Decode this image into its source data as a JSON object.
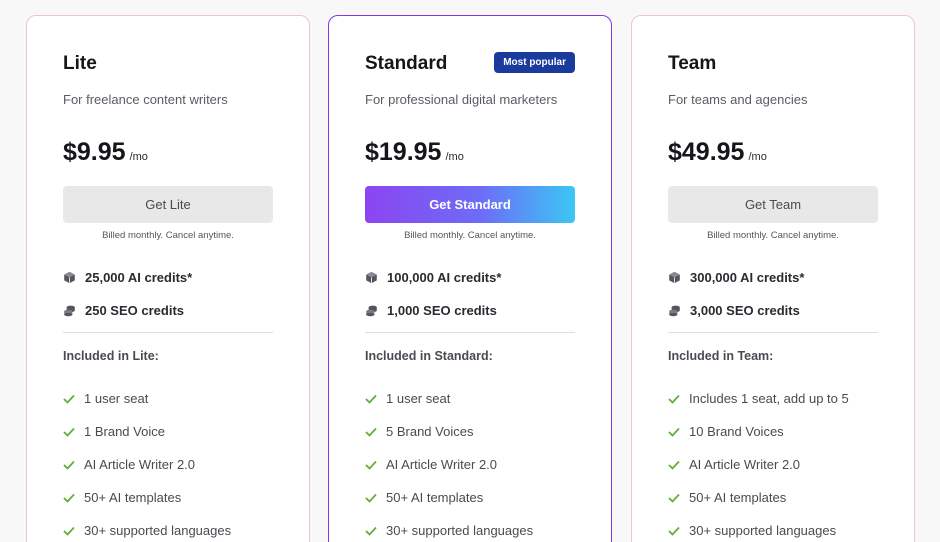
{
  "colors": {
    "accent_border": "#7b39e8",
    "badge_bg": "#1a3a9e",
    "check": "#5fae3a",
    "gradient_start": "#8c45f0",
    "gradient_end": "#3bc7f4"
  },
  "plans": [
    {
      "name": "Lite",
      "description": "For freelance content writers",
      "price": "$9.95",
      "period": "/mo",
      "cta": "Get Lite",
      "billing_note": "Billed monthly. Cancel anytime.",
      "ai_credits": "25,000 AI credits*",
      "seo_credits": "250 SEO credits",
      "included_label": "Included in Lite:",
      "features": [
        "1 user seat",
        "1 Brand Voice",
        "AI Article Writer 2.0",
        "50+ AI templates",
        "30+ supported languages"
      ]
    },
    {
      "name": "Standard",
      "badge": "Most popular",
      "description": "For professional digital marketers",
      "price": "$19.95",
      "period": "/mo",
      "cta": "Get Standard",
      "billing_note": "Billed monthly. Cancel anytime.",
      "ai_credits": "100,000 AI credits*",
      "seo_credits": "1,000 SEO credits",
      "included_label": "Included in Standard:",
      "features": [
        "1 user seat",
        "5 Brand Voices",
        "AI Article Writer 2.0",
        "50+ AI templates",
        "30+ supported languages"
      ]
    },
    {
      "name": "Team",
      "description": "For teams and agencies",
      "price": "$49.95",
      "period": "/mo",
      "cta": "Get Team",
      "billing_note": "Billed monthly. Cancel anytime.",
      "ai_credits": "300,000 AI credits*",
      "seo_credits": "3,000 SEO credits",
      "included_label": "Included in Team:",
      "features": [
        "Includes 1 seat, add up to 5",
        "10 Brand Voices",
        "AI Article Writer 2.0",
        "50+ AI templates",
        "30+ supported languages"
      ]
    }
  ]
}
